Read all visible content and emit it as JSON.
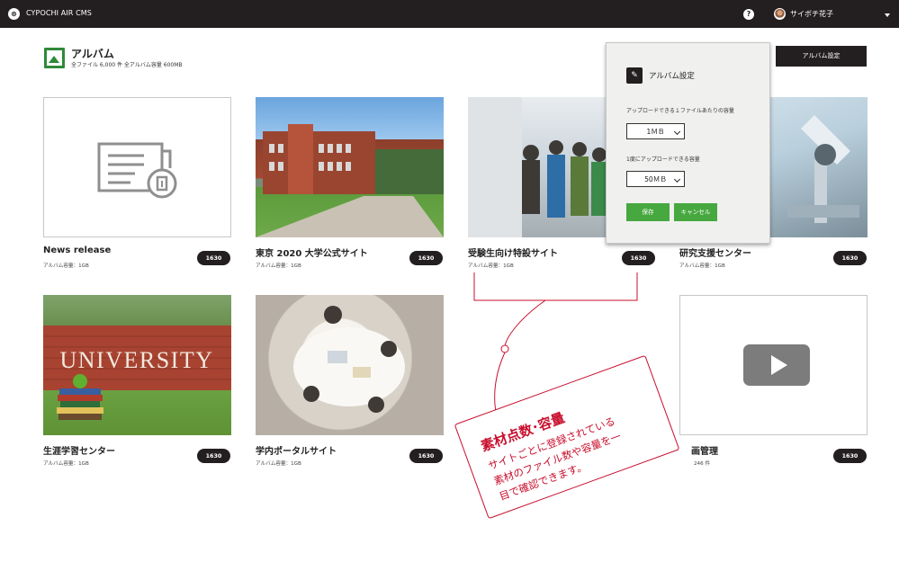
{
  "app": {
    "name": "CYPOCHI AIR CMS",
    "logo_glyph": "⊛"
  },
  "header": {
    "help_glyph": "?",
    "user_name": "サイボチ花子"
  },
  "page": {
    "title": "アルバム",
    "stats": "全ファイル 6,000 件   全アルバム容量 600MB",
    "settings_button": "アルバム設定"
  },
  "albums": [
    {
      "title": "News release",
      "sub": "アルバム容量：1GB",
      "count": "1630"
    },
    {
      "title": "東京 2020 大学公式サイト",
      "sub": "アルバム容量：1GB",
      "count": "1630"
    },
    {
      "title": "受験生向け特設サイト",
      "sub": "アルバム容量：1GB",
      "count": "1630"
    },
    {
      "title": "研究支援センター",
      "sub": "アルバム容量：1GB",
      "count": "1630"
    },
    {
      "title": "生涯学習センター",
      "sub": "アルバム容量：1GB",
      "count": "1630"
    },
    {
      "title": "学内ポータルサイト",
      "sub": "アルバム容量：1GB",
      "count": "1630"
    },
    {
      "title": "画管理",
      "sub": "246 件",
      "count": "1630"
    }
  ],
  "popover": {
    "title": "アルバム設定",
    "label_per_file": "アップロードできる１ファイルあたりの容量",
    "per_file_value": "1ＭＢ",
    "label_per_batch": "1度にアップロードできる容量",
    "per_batch_value": "50ＭＢ",
    "save": "保存",
    "cancel": "キャンセル"
  },
  "note": {
    "title": "素材点数･容量",
    "line1": "サイトごとに登録されている",
    "line2": "素材のファイル数や容量を一",
    "line3": "目で確認できます。"
  },
  "photo_overlay_text": {
    "university": "UNIVERSITY"
  },
  "colors": {
    "topbar": "#231f20",
    "accent_green": "#46a83e",
    "album_icon_green": "#2f8a38",
    "annotation_red": "#c8102e"
  }
}
